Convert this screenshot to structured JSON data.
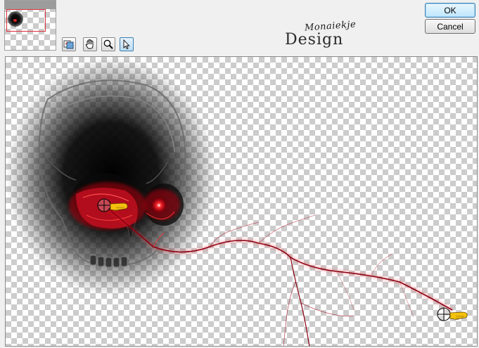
{
  "dialog": {
    "ok_label": "OK",
    "cancel_label": "Cancel"
  },
  "toolbar": {
    "tools": [
      {
        "name": "toggle-preview-icon",
        "active": false
      },
      {
        "name": "hand-pan-icon",
        "active": false
      },
      {
        "name": "zoom-magnifier-icon",
        "active": false
      },
      {
        "name": "arrow-pointer-icon",
        "active": true
      }
    ]
  },
  "logo": {
    "script_text": "Monaiekje",
    "main_text": "Design"
  },
  "preview": {
    "handles": [
      {
        "name": "start-point-handle"
      },
      {
        "name": "end-point-handle"
      }
    ]
  },
  "colors": {
    "accent_blue": "#3c7fb1",
    "lightning_red": "#c01020",
    "eye_red": "#ff2020",
    "pointer_yellow": "#f4c20d"
  }
}
